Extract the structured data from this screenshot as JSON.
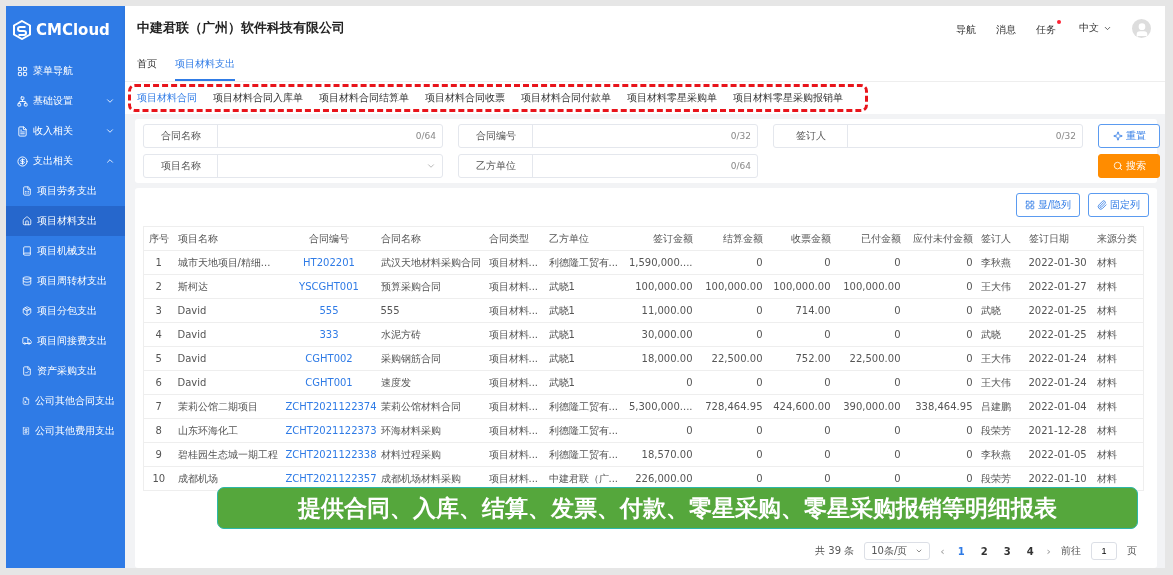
{
  "logo": {
    "text": "CMCloud"
  },
  "header": {
    "company": "中建君联（广州）软件科技有限公司",
    "links": [
      {
        "label": "导航",
        "badge": false
      },
      {
        "label": "消息",
        "badge": false
      },
      {
        "label": "任务",
        "badge": true
      }
    ],
    "language": "中文"
  },
  "sidebar": {
    "items": [
      {
        "label": "菜单导航"
      },
      {
        "label": "基础设置",
        "expanded": false
      },
      {
        "label": "收入相关",
        "expanded": false
      },
      {
        "label": "支出相关",
        "expanded": true,
        "children": [
          {
            "label": "项目劳务支出",
            "selected": false
          },
          {
            "label": "项目材料支出",
            "selected": true
          },
          {
            "label": "项目机械支出",
            "selected": false
          },
          {
            "label": "项目周转材支出",
            "selected": false
          },
          {
            "label": "项目分包支出",
            "selected": false
          },
          {
            "label": "项目间接费支出",
            "selected": false
          },
          {
            "label": "资产采购支出",
            "selected": false
          },
          {
            "label": "公司其他合同支出",
            "selected": false
          },
          {
            "label": "公司其他费用支出",
            "selected": false
          }
        ]
      }
    ]
  },
  "breadcrumb_tabs": [
    {
      "label": "首页",
      "selected": false
    },
    {
      "label": "项目材料支出",
      "selected": true
    }
  ],
  "sub_tabs": [
    {
      "label": "项目材料合同",
      "selected": true
    },
    {
      "label": "项目材料合同入库单",
      "selected": false
    },
    {
      "label": "项目材料合同结算单",
      "selected": false
    },
    {
      "label": "项目材料合同收票",
      "selected": false
    },
    {
      "label": "项目材料合同付款单",
      "selected": false
    },
    {
      "label": "项目材料零星采购单",
      "selected": false
    },
    {
      "label": "项目材料零星采购报销单",
      "selected": false
    }
  ],
  "filters": [
    {
      "label": "合同名称",
      "kind": "text",
      "counter": "0/64"
    },
    {
      "label": "合同编号",
      "kind": "text",
      "counter": "0/32"
    },
    {
      "label": "签订人",
      "kind": "text",
      "counter": "0/32"
    },
    {
      "label": "项目名称",
      "kind": "select"
    },
    {
      "label": "乙方单位",
      "kind": "text",
      "counter": "0/64"
    }
  ],
  "filter_buttons": [
    {
      "label": "重置",
      "kind": "reset"
    },
    {
      "label": "搜索",
      "kind": "search"
    }
  ],
  "table_buttons": [
    {
      "label": "显/隐列",
      "kind": "columns"
    },
    {
      "label": "固定列",
      "kind": "pin"
    }
  ],
  "table": {
    "columns": [
      {
        "label": "序号",
        "kind": "index"
      },
      {
        "label": "项目名称",
        "kind": "text"
      },
      {
        "label": "合同编号",
        "kind": "link"
      },
      {
        "label": "合同名称",
        "kind": "text"
      },
      {
        "label": "合同类型",
        "kind": "text"
      },
      {
        "label": "乙方单位",
        "kind": "text"
      },
      {
        "label": "签订金额",
        "kind": "number"
      },
      {
        "label": "结算金额",
        "kind": "number"
      },
      {
        "label": "收票金额",
        "kind": "number"
      },
      {
        "label": "已付金额",
        "kind": "number"
      },
      {
        "label": "应付未付金额",
        "kind": "number"
      },
      {
        "label": "签订人",
        "kind": "text"
      },
      {
        "label": "签订日期",
        "kind": "date"
      },
      {
        "label": "来源分类",
        "kind": "text"
      }
    ],
    "rows": [
      [
        "1",
        "城市天地项目/精细...",
        "HT202201",
        "武汉天地材料采购合同",
        "项目材料...",
        "利德隆工贸有...",
        "1,590,000....",
        "0",
        "0",
        "0",
        "0",
        "李秋燕",
        "2022-01-30",
        "材料"
      ],
      [
        "2",
        "斯柯达",
        "YSCGHT001",
        "预算采购合同",
        "项目材料...",
        "武晓1",
        "100,000.00",
        "100,000.00",
        "100,000.00",
        "100,000.00",
        "0",
        "王大伟",
        "2022-01-27",
        "材料"
      ],
      [
        "3",
        "David",
        "555",
        "555",
        "项目材料...",
        "武晓1",
        "11,000.00",
        "0",
        "714.00",
        "0",
        "0",
        "武晓",
        "2022-01-25",
        "材料"
      ],
      [
        "4",
        "David",
        "333",
        "水泥方砖",
        "项目材料...",
        "武晓1",
        "30,000.00",
        "0",
        "0",
        "0",
        "0",
        "武晓",
        "2022-01-25",
        "材料"
      ],
      [
        "5",
        "David",
        "CGHT002",
        "采购钢筋合同",
        "项目材料...",
        "武晓1",
        "18,000.00",
        "22,500.00",
        "752.00",
        "22,500.00",
        "0",
        "王大伟",
        "2022-01-24",
        "材料"
      ],
      [
        "6",
        "David",
        "CGHT001",
        "速度发",
        "项目材料...",
        "武晓1",
        "0",
        "0",
        "0",
        "0",
        "0",
        "王大伟",
        "2022-01-24",
        "材料"
      ],
      [
        "7",
        "茉莉公馆二期项目",
        "ZCHT2021122374",
        "茉莉公馆材料合同",
        "项目材料...",
        "利德隆工贸有...",
        "5,300,000....",
        "728,464.95",
        "424,600.00",
        "390,000.00",
        "338,464.95",
        "吕建鹏",
        "2022-01-04",
        "材料"
      ],
      [
        "8",
        "山东环海化工",
        "ZCHT2021122373",
        "环海材料采购",
        "项目材料...",
        "利德隆工贸有...",
        "0",
        "0",
        "0",
        "0",
        "0",
        "段荣芳",
        "2021-12-28",
        "材料"
      ],
      [
        "9",
        "碧桂园生态城一期工程",
        "ZCHT2021122338",
        "材料过程采购",
        "项目材料...",
        "利德隆工贸有...",
        "18,570.00",
        "0",
        "0",
        "0",
        "0",
        "李秋燕",
        "2022-01-05",
        "材料"
      ],
      [
        "10",
        "成都机场",
        "ZCHT2021122357",
        "成都机场材料采购",
        "项目材料...",
        "中建君联（广...",
        "226,000.00",
        "0",
        "0",
        "0",
        "0",
        "段荣芳",
        "2022-01-10",
        "材料"
      ]
    ]
  },
  "pagination": {
    "total": "共 39 条",
    "page_size": "10条/页",
    "prev": "‹",
    "pages": [
      {
        "label": "1",
        "selected": true
      },
      {
        "label": "2",
        "selected": false
      },
      {
        "label": "3",
        "selected": false
      },
      {
        "label": "4",
        "selected": false
      }
    ],
    "next": "›",
    "goto_label": "前往",
    "goto_value": "1",
    "goto_suffix": "页"
  },
  "banner": {
    "text": "提供合同、入库、结算、发票、付款、零星采购、零星采购报销等明细报表"
  }
}
